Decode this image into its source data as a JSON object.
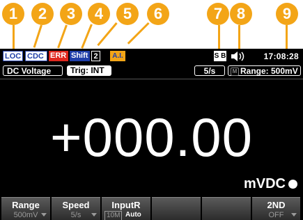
{
  "callouts": [
    "1",
    "2",
    "3",
    "4",
    "5",
    "6",
    "7",
    "8",
    "9"
  ],
  "colors": {
    "callout": "#f3a517",
    "screen_bg": "#000000",
    "chip_blue": "#1f3ea8",
    "chip_red": "#e0271e",
    "text": "#ffffff",
    "dim_text": "#9a9a9a"
  },
  "status_bar": {
    "loc": "LOC",
    "cdc": "CDC",
    "err": "ERR",
    "shift": "Shift",
    "memory_slot": "2",
    "ai": "A.I.",
    "sb": "S B",
    "beeper_icon": "speaker-icon",
    "time": "17:08:28"
  },
  "info_bar": {
    "function": "DC Voltage",
    "trigger": "Trig: INT",
    "rate": "5/s",
    "range_mode_icon": "M",
    "range": "Range: 500mV"
  },
  "display": {
    "reading": "+000.00",
    "unit": "mVDC"
  },
  "softkeys": [
    {
      "label": "Range",
      "value": "500mV"
    },
    {
      "label": "Speed",
      "value": "5/s"
    },
    {
      "label": "InputR",
      "option_off": "10M",
      "option_on": "Auto"
    },
    {
      "label": "",
      "value": ""
    },
    {
      "label": "",
      "value": ""
    },
    {
      "label": "2ND",
      "value": "OFF"
    }
  ]
}
